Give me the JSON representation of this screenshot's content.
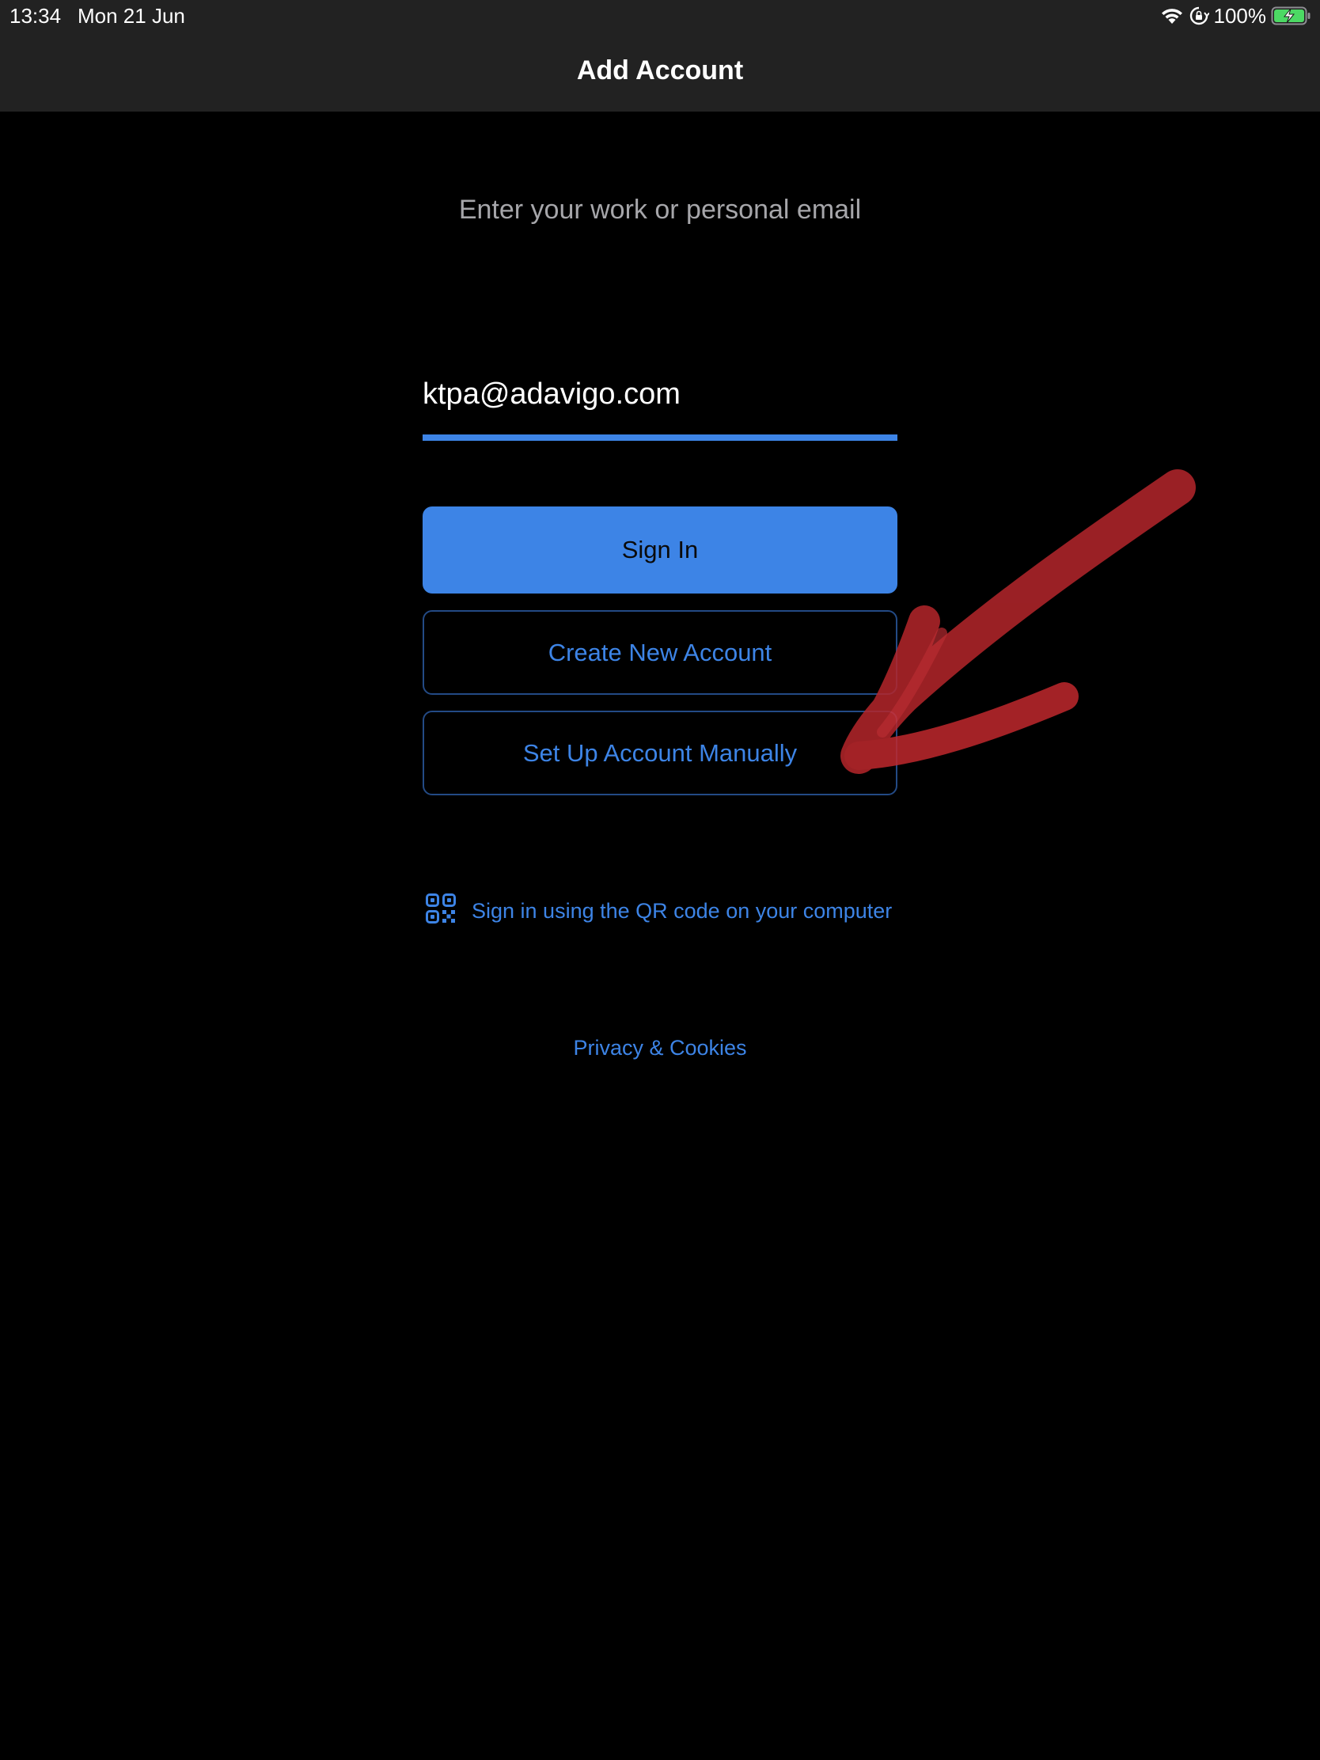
{
  "status_bar": {
    "time": "13:34",
    "date": "Mon 21 Jun",
    "battery_percent": "100%",
    "icons": [
      "wifi-icon",
      "orientation-lock-icon",
      "battery-charging-icon"
    ]
  },
  "nav": {
    "title": "Add Account"
  },
  "form": {
    "prompt": "Enter your work or personal email",
    "email_value": "ktpa@adavigo.com"
  },
  "buttons": {
    "sign_in": "Sign In",
    "create_account": "Create New Account",
    "setup_manual": "Set Up Account Manually"
  },
  "qr": {
    "icon": "qr-code-icon",
    "label": "Sign in using the QR code on your computer"
  },
  "footer": {
    "privacy": "Privacy & Cookies"
  },
  "annotation": {
    "type": "red-arrow",
    "points_to": "Set Up Account Manually"
  },
  "colors": {
    "accent": "#3d84e6",
    "header_bg": "#222222",
    "background": "#000000",
    "prompt_text": "#a6a6aa",
    "annotation": "#c0282d"
  }
}
